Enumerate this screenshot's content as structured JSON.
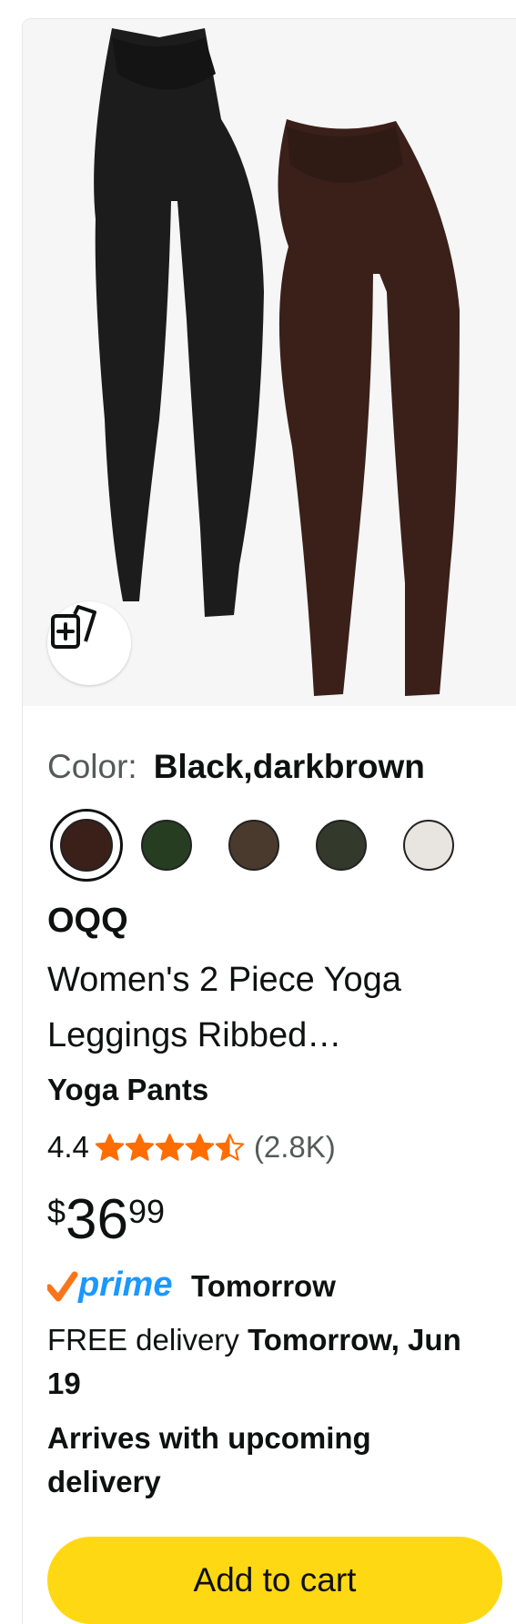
{
  "product": {
    "color_label": "Color:",
    "color_value": "Black,darkbrown",
    "swatch_colors": [
      "#3a2019",
      "#263d22",
      "#4a3a2e",
      "#333a2b",
      "#e8e4df"
    ],
    "brand": "OQQ",
    "title": "Women's 2 Piece Yoga Leggings Ribbed…",
    "subtitle": "Yoga Pants",
    "rating_value": "4.4",
    "rating_stars": 4.4,
    "rating_count": "(2.8K)",
    "price_symbol": "$",
    "price_whole": "36",
    "price_fraction": "99",
    "prime_word": "prime",
    "prime_when": "Tomorrow",
    "delivery_prefix": "FREE delivery",
    "delivery_date": "Tomorrow, Jun 19",
    "arrives": "Arrives with upcoming delivery",
    "add_to_cart": "Add to cart"
  },
  "icons": {
    "similar": "add-to-collection-icon",
    "star": "star-icon",
    "prime_check": "prime-check-icon"
  },
  "colors": {
    "star": "#ff6d00",
    "prime_blue": "#1a98ff",
    "prime_check": "#f7761b",
    "cart_button": "#ffd814"
  }
}
